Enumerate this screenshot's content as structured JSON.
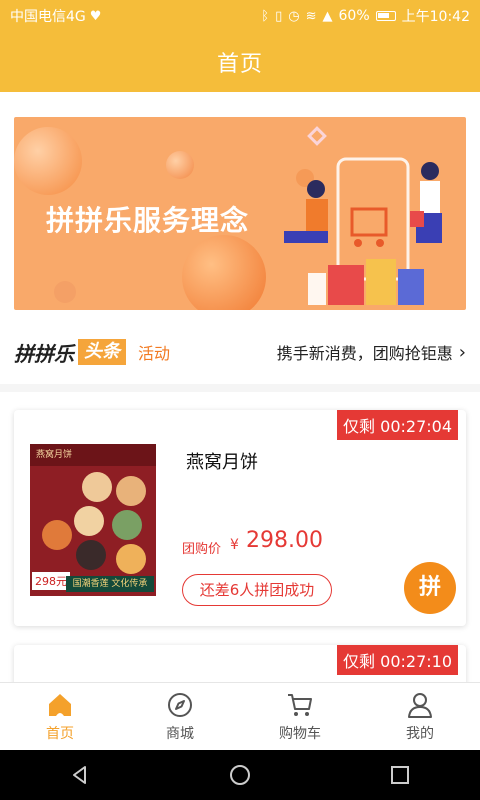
{
  "status_bar": {
    "carrier": "中国电信4G",
    "battery": "60%",
    "time": "上午10:42",
    "icons": [
      "heart-icon",
      "bluetooth-icon",
      "vibrate-icon",
      "alarm-icon",
      "wifi-icon",
      "signal-icon",
      "battery-icon"
    ]
  },
  "header": {
    "title": "首页"
  },
  "banner": {
    "title": "拼拼乐服务理念"
  },
  "news": {
    "brand": "拼拼乐",
    "tag": "头条",
    "activity": "活动",
    "headline": "携手新消费，团购抢钜惠"
  },
  "products": [
    {
      "timer": "仅剩 00:27:04",
      "name": "燕窝月饼",
      "price_label": "团购价",
      "currency": "¥",
      "price": "298.00",
      "progress": "还差6人拼团成功",
      "join_label": "拼",
      "image_text": {
        "brand": "燕窝月饼",
        "price": "298元",
        "band": "国潮香莲 文化传承"
      }
    },
    {
      "timer": "仅剩 00:27:10"
    }
  ],
  "tabbar": {
    "items": [
      {
        "label": "首页",
        "icon": "home-icon",
        "active": true
      },
      {
        "label": "商城",
        "icon": "compass-icon",
        "active": false
      },
      {
        "label": "购物车",
        "icon": "cart-icon",
        "active": false
      },
      {
        "label": "我的",
        "icon": "user-icon",
        "active": false
      }
    ]
  },
  "colors": {
    "brand_yellow": "#f5bd3a",
    "accent_orange": "#f4a12b",
    "price_red": "#e53935"
  }
}
